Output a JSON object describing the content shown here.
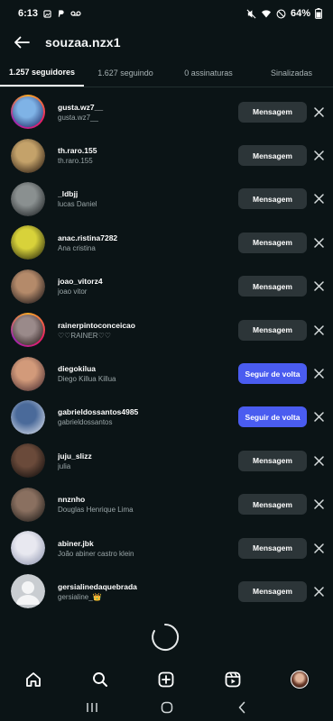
{
  "status": {
    "time": "6:13",
    "battery": "64%"
  },
  "header": {
    "title": "souzaa.nzx1"
  },
  "tabs": [
    {
      "label": "1.257 seguidores",
      "active": true
    },
    {
      "label": "1.627 seguindo",
      "active": false
    },
    {
      "label": "0 assinaturas",
      "active": false
    },
    {
      "label": "Sinalizadas",
      "active": false
    }
  ],
  "followers": [
    {
      "username": "gusta.wz7__",
      "name": "gusta.wz7__",
      "button": "Mensagem",
      "type": "message",
      "ring": true,
      "colors": [
        "#7fb3e6",
        "#2c3f7a"
      ]
    },
    {
      "username": "th.raro.155",
      "name": "th.raro.155",
      "button": "Mensagem",
      "type": "message",
      "ring": false,
      "colors": [
        "#c4a26a",
        "#3b2a1a"
      ]
    },
    {
      "username": "_ldbjj",
      "name": "lucas Daniel",
      "button": "Mensagem",
      "type": "message",
      "ring": false,
      "colors": [
        "#8a9090",
        "#2a2e30"
      ]
    },
    {
      "username": "anac.ristina7282",
      "name": "Ana cristina",
      "button": "Mensagem",
      "type": "message",
      "ring": false,
      "colors": [
        "#d8d23a",
        "#3a3a10"
      ]
    },
    {
      "username": "joao_vitorz4",
      "name": "joao vitor",
      "button": "Mensagem",
      "type": "message",
      "ring": false,
      "colors": [
        "#b48a6a",
        "#2b2220"
      ]
    },
    {
      "username": "rainerpintoconceicao",
      "name": "♡♡RAINER♡♡",
      "button": "Mensagem",
      "type": "message",
      "ring": true,
      "colors": [
        "#9a8a8a",
        "#3a2a2a"
      ]
    },
    {
      "username": "diegokilua",
      "name": "Diego Killua Killua",
      "button": "Seguir de volta",
      "type": "follow",
      "ring": false,
      "colors": [
        "#d29a7a",
        "#5a3a3a"
      ]
    },
    {
      "username": "gabrieldossantos4985",
      "name": "gabrieldossantos",
      "button": "Seguir de volta",
      "type": "follow",
      "ring": false,
      "colors": [
        "#4a6a9a",
        "#c8d0e0"
      ]
    },
    {
      "username": "juju_slizz",
      "name": "julia",
      "button": "Mensagem",
      "type": "message",
      "ring": false,
      "colors": [
        "#6a4a3a",
        "#1a1412"
      ]
    },
    {
      "username": "nnznho",
      "name": "Douglas Henrique Lima",
      "button": "Mensagem",
      "type": "message",
      "ring": false,
      "colors": [
        "#8a7060",
        "#2a2420"
      ]
    },
    {
      "username": "abiner.jbk",
      "name": "João abiner castro klein",
      "button": "Mensagem",
      "type": "message",
      "ring": false,
      "colors": [
        "#e8e8f0",
        "#9aa0b8"
      ]
    },
    {
      "username": "gersialinedaquebrada",
      "name": "gersialine_👑",
      "button": "Mensagem",
      "type": "message",
      "ring": false,
      "default_avatar": true,
      "colors": [
        "#c8ccd0",
        "#8a9096"
      ]
    }
  ],
  "nav": {
    "items": [
      "home-icon",
      "search-icon",
      "create-icon",
      "reels-icon",
      "profile-avatar"
    ]
  },
  "system_nav": {
    "items": [
      "recents-icon",
      "home-circle-icon",
      "back-chevron-icon"
    ]
  }
}
